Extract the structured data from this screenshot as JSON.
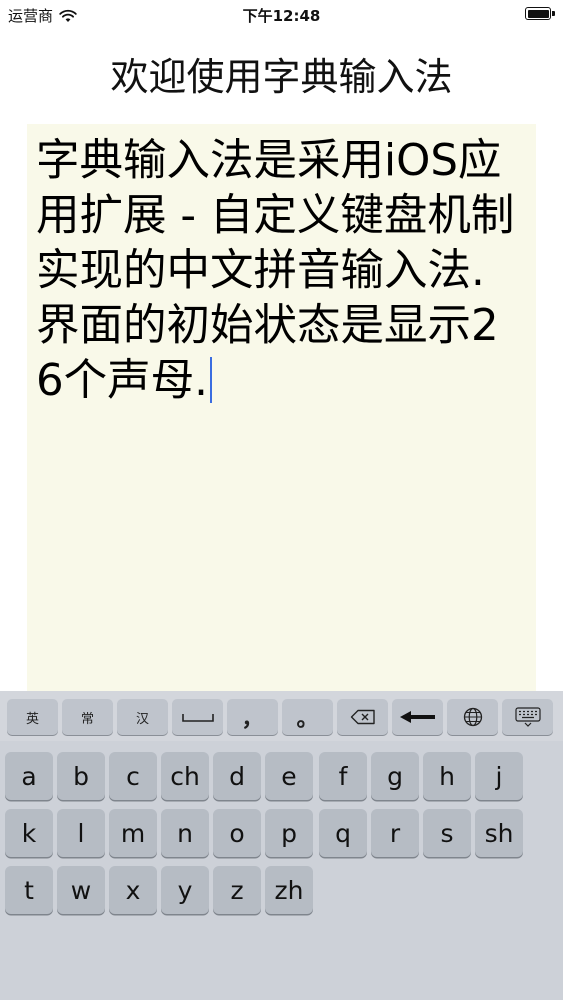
{
  "status_bar": {
    "carrier": "运营商",
    "time": "下午12:48",
    "battery_percent": 100
  },
  "header": {
    "title": "欢迎使用字典输入法"
  },
  "editor": {
    "text": "字典输入法是采用iOS应用扩展 - 自定义键盘机制实现的中文拼音输入法. 界面的初始状态是显示26个声母."
  },
  "keyboard": {
    "toolbar": {
      "english": "英",
      "common": "常",
      "chinese": "汉",
      "comma": "，",
      "period": "。"
    },
    "rows": [
      [
        "a",
        "b",
        "c",
        "ch",
        "d",
        "e",
        "f",
        "g",
        "h",
        "j"
      ],
      [
        "k",
        "l",
        "m",
        "n",
        "o",
        "p",
        "q",
        "r",
        "s",
        "sh"
      ],
      [
        "t",
        "w",
        "x",
        "y",
        "z",
        "zh"
      ]
    ]
  },
  "icons": {
    "wifi": "wifi-icon",
    "battery": "battery-icon",
    "space": "space-bar-icon",
    "backspace": "backspace-icon",
    "return": "return-arrow-icon",
    "globe": "globe-icon",
    "keyboard": "keyboard-dismiss-icon"
  },
  "colors": {
    "editor_bg": "#f9f9e9",
    "keyboard_bg": "#cdd1d8",
    "key_bg": "#b6bcc4",
    "caret": "#3b6de0"
  }
}
